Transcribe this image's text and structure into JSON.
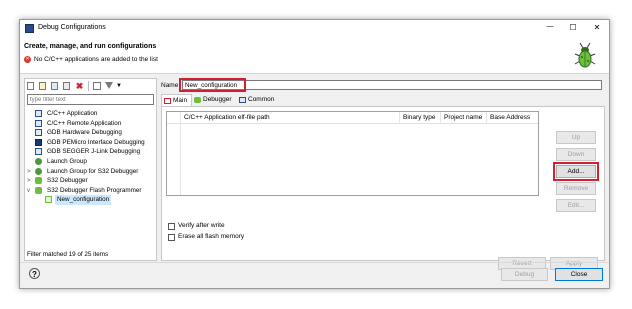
{
  "window": {
    "title": "Debug Configurations",
    "minimize_glyph": "—",
    "maximize_glyph": "☐",
    "close_glyph": "✕"
  },
  "banner": {
    "heading": "Create, manage, and run configurations",
    "error_text": "No C/C++ applications are added to the list",
    "error_icon": "error-icon",
    "logo_icon": "bug-logo-icon"
  },
  "sidebar": {
    "toolbar_icons": [
      "new-configuration-icon",
      "new-prototype-icon",
      "export-icon",
      "duplicate-icon",
      "delete-icon",
      "collapse-all-icon",
      "filter-icon",
      "chevron-down-icon"
    ],
    "filter_placeholder": "type filter text",
    "tree": [
      {
        "label": "C/C++ Application",
        "icon": "c-app-icon"
      },
      {
        "label": "C/C++ Remote Application",
        "icon": "c-app-icon"
      },
      {
        "label": "GDB Hardware Debugging",
        "icon": "c-app-icon"
      },
      {
        "label": "GDB PEMicro Interface Debugging",
        "icon": "pemicro-icon"
      },
      {
        "label": "GDB SEGGER J-Link Debugging",
        "icon": "c-app-icon"
      },
      {
        "label": "Launch Group",
        "icon": "launch-group-icon"
      },
      {
        "label": "Launch Group for S32 Debugger",
        "icon": "launch-group-icon",
        "expander": ">"
      },
      {
        "label": "S32 Debugger",
        "icon": "s32-debugger-icon",
        "expander": ">"
      },
      {
        "label": "S32 Debugger Flash Programmer",
        "icon": "s32-debugger-icon",
        "expander": "v"
      },
      {
        "label": "New_configuration",
        "icon": "configuration-icon",
        "selected": true
      }
    ],
    "status": "Filter matched 19 of 25 items"
  },
  "main": {
    "name_label": "Name:",
    "name_value": "New_configuration",
    "tabs": [
      {
        "label": "Main",
        "icon": "main-tab-icon"
      },
      {
        "label": "Debugger",
        "icon": "debugger-tab-icon"
      },
      {
        "label": "Common",
        "icon": "common-tab-icon"
      }
    ],
    "table_columns": [
      "C/C++ Application elf-file path",
      "Binary type",
      "Project name",
      "Base Address"
    ],
    "side_buttons": {
      "up": "Up",
      "down": "Down",
      "add": "Add...",
      "remove": "Remove",
      "edit": "Edit..."
    },
    "checkboxes": {
      "verify": "Verify after write",
      "erase": "Erase all flash memory"
    },
    "revert": "Revert",
    "apply": "Apply"
  },
  "footer": {
    "help_glyph": "?",
    "debug": "Debug",
    "close": "Close"
  },
  "colors": {
    "accent": "#0078d7",
    "highlight": "#d1202f",
    "error": "#d9372b",
    "selection": "#cce8ff"
  }
}
